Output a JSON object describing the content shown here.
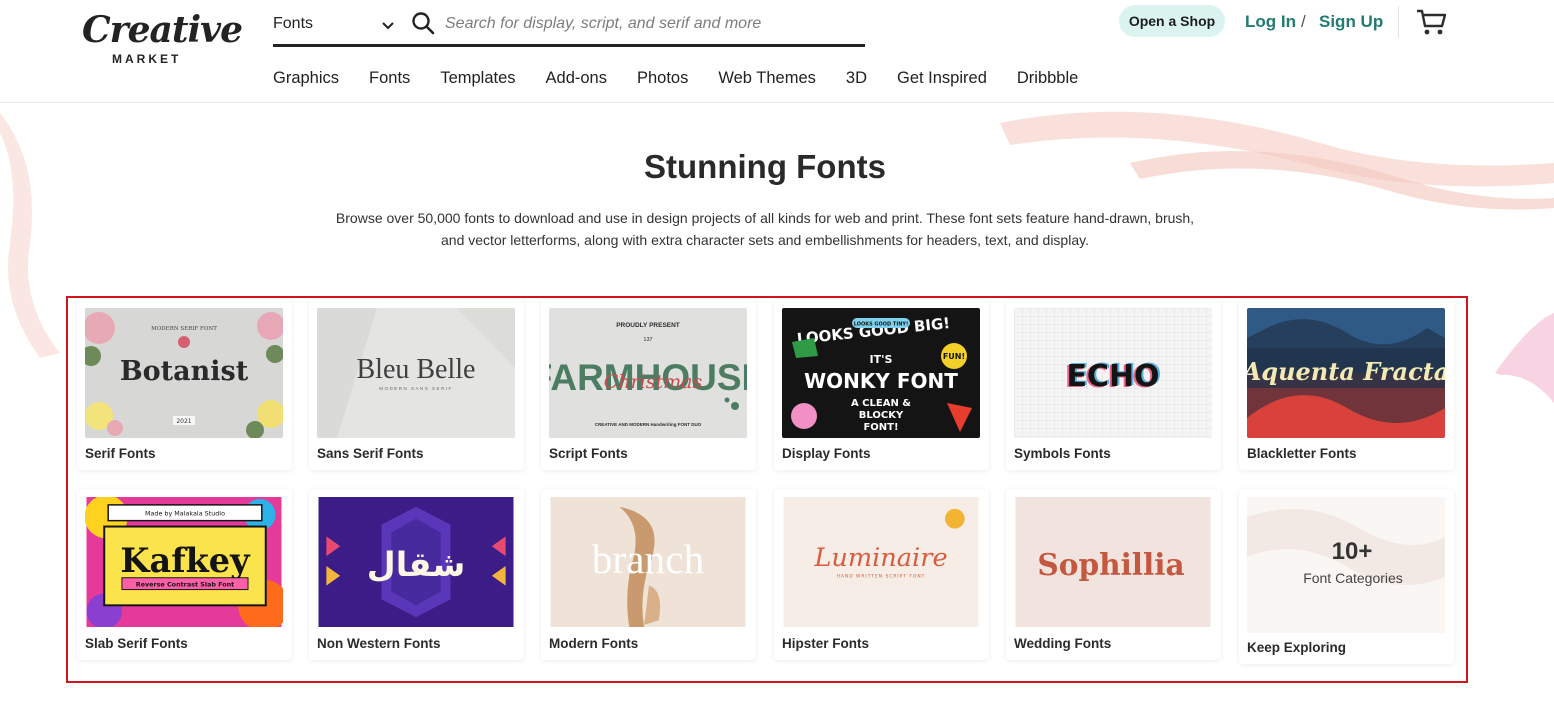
{
  "brand": {
    "name": "Creative",
    "sub": "MARKET"
  },
  "search": {
    "category": "Fonts",
    "placeholder": "Search for display, script, and serif and more"
  },
  "header": {
    "open_shop": "Open a Shop",
    "login": "Log In",
    "separator": "/",
    "signup": "Sign Up",
    "cart_icon": "cart-icon"
  },
  "nav": [
    "Graphics",
    "Fonts",
    "Templates",
    "Add-ons",
    "Photos",
    "Web Themes",
    "3D",
    "Get Inspired",
    "Dribbble"
  ],
  "hero": {
    "title": "Stunning Fonts",
    "description": "Browse over 50,000 fonts to download and use in design projects of all kinds for web and print. These font sets feature hand-drawn, brush, and vector letterforms, along with extra character sets and embellishments for headers, text, and display."
  },
  "categories": [
    {
      "label": "Serif Fonts",
      "thumb": {
        "title": "Botanist",
        "top": "MODERN SERIF FONT",
        "bottom": "2021"
      }
    },
    {
      "label": "Sans Serif Fonts",
      "thumb": {
        "title": "Bleu Belle",
        "sub": "MODERN SANS SERIF"
      }
    },
    {
      "label": "Script Fonts",
      "thumb": {
        "top": "PROUDLY PRESENT",
        "num": "137",
        "title": "FARMHOUSE",
        "overlay": "Christmas",
        "bottom": "CREATIVE AND MODERN Handwriting FONT DUO"
      }
    },
    {
      "label": "Display Fonts",
      "thumb": {
        "line1": "LOOKS GOOD BIG!",
        "badge": "LOOKS GOOD TINY!",
        "its": "IT'S",
        "title": "WONKY FONT",
        "line3": "A CLEAN &",
        "line4": "BLOCKY",
        "line5": "FONT!",
        "fun": "FUN!"
      }
    },
    {
      "label": "Symbols Fonts",
      "thumb": {
        "title": "ECHO"
      }
    },
    {
      "label": "Blackletter Fonts",
      "thumb": {
        "title": "Aquenta Fracta"
      }
    },
    {
      "label": "Slab Serif Fonts",
      "thumb": {
        "top": "Made by Malakala Studio",
        "title": "Kafkey",
        "sub": "Reverse Contrast Slab Font"
      }
    },
    {
      "label": "Non Western Fonts",
      "thumb": {
        "title": "شقال"
      }
    },
    {
      "label": "Modern Fonts",
      "thumb": {
        "title": "branch"
      }
    },
    {
      "label": "Hipster Fonts",
      "thumb": {
        "title": "Luminaire",
        "sub": "HAND WRITTEN SCRIPT FONT"
      }
    },
    {
      "label": "Wedding Fonts",
      "thumb": {
        "title": "Sophillia"
      }
    },
    {
      "label": "Keep Exploring",
      "thumb": {
        "count": "10+",
        "sub": "Font Categories"
      }
    }
  ],
  "colors": {
    "accent": "#217b70",
    "shop_bg": "#dbf4ef",
    "frame": "#d0161d"
  }
}
